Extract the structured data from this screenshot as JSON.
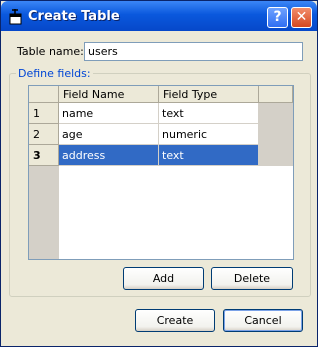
{
  "window": {
    "title": "Create Table",
    "help_label": "?",
    "close_label": "✕"
  },
  "form": {
    "table_name_label": "Table name:",
    "table_name_value": "users"
  },
  "fields_group": {
    "legend": "Define fields:",
    "columns": [
      "Field Name",
      "Field Type"
    ],
    "rows": [
      {
        "num": "1",
        "name": "name",
        "type": "text",
        "selected": false
      },
      {
        "num": "2",
        "name": "age",
        "type": "numeric",
        "selected": false
      },
      {
        "num": "3",
        "name": "address",
        "type": "text",
        "selected": true
      }
    ],
    "add_label": "Add",
    "delete_label": "Delete"
  },
  "actions": {
    "create_label": "Create",
    "cancel_label": "Cancel"
  },
  "colors": {
    "titlebar": "#0a58dd",
    "selection": "#316ac5",
    "dialog_bg": "#ece9d8",
    "legend_text": "#0046d5"
  },
  "icons": {
    "app": "table-window-icon",
    "help": "help-icon",
    "close": "close-icon"
  }
}
